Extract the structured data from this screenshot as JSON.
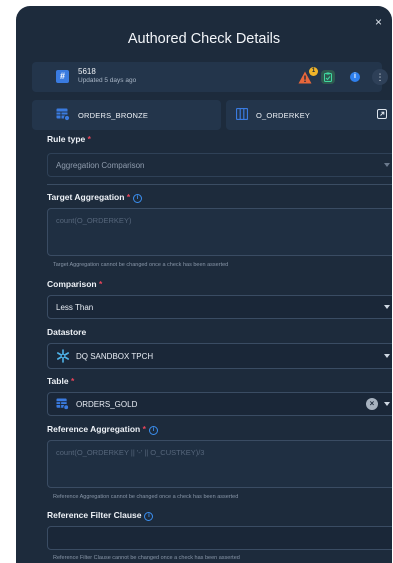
{
  "title": "Authored Check Details",
  "check": {
    "id_badge": "#",
    "id": "5618",
    "updated": "Updated 5 days ago",
    "warning_count": "1"
  },
  "container": {
    "name": "ORDERS_BRONZE"
  },
  "field_name": {
    "name": "O_ORDERKEY"
  },
  "rule_type": {
    "label": "Rule type",
    "value": "Aggregation Comparison"
  },
  "target_aggregation": {
    "label": "Target Aggregation",
    "placeholder": "count(O_ORDERKEY)",
    "hint": "Target Aggregation cannot be changed once a check has been asserted"
  },
  "comparison": {
    "label": "Comparison",
    "value": "Less Than"
  },
  "datastore": {
    "label": "Datastore",
    "value": "DQ SANDBOX TPCH"
  },
  "table": {
    "label": "Table",
    "value": "ORDERS_GOLD"
  },
  "reference_aggregation": {
    "label": "Reference Aggregation",
    "placeholder": "count(O_ORDERKEY || '-' || O_CUSTKEY)/3",
    "hint": "Reference Aggregation cannot be changed once a check has been asserted"
  },
  "reference_filter": {
    "label": "Reference Filter Clause",
    "hint": "Reference Filter Clause cannot be changed once a check has been asserted"
  },
  "icons": {
    "close": "×",
    "info": "i",
    "more": "⋮",
    "required": "*",
    "clear": "×"
  },
  "colors": {
    "modal_bg": "#1d2b3c",
    "accent_blue": "#3a7be0",
    "required_red": "#e8445a",
    "warning_orange": "#e8663a",
    "badge_yellow": "#f0b429",
    "snowflake_blue": "#4fb3e8"
  }
}
